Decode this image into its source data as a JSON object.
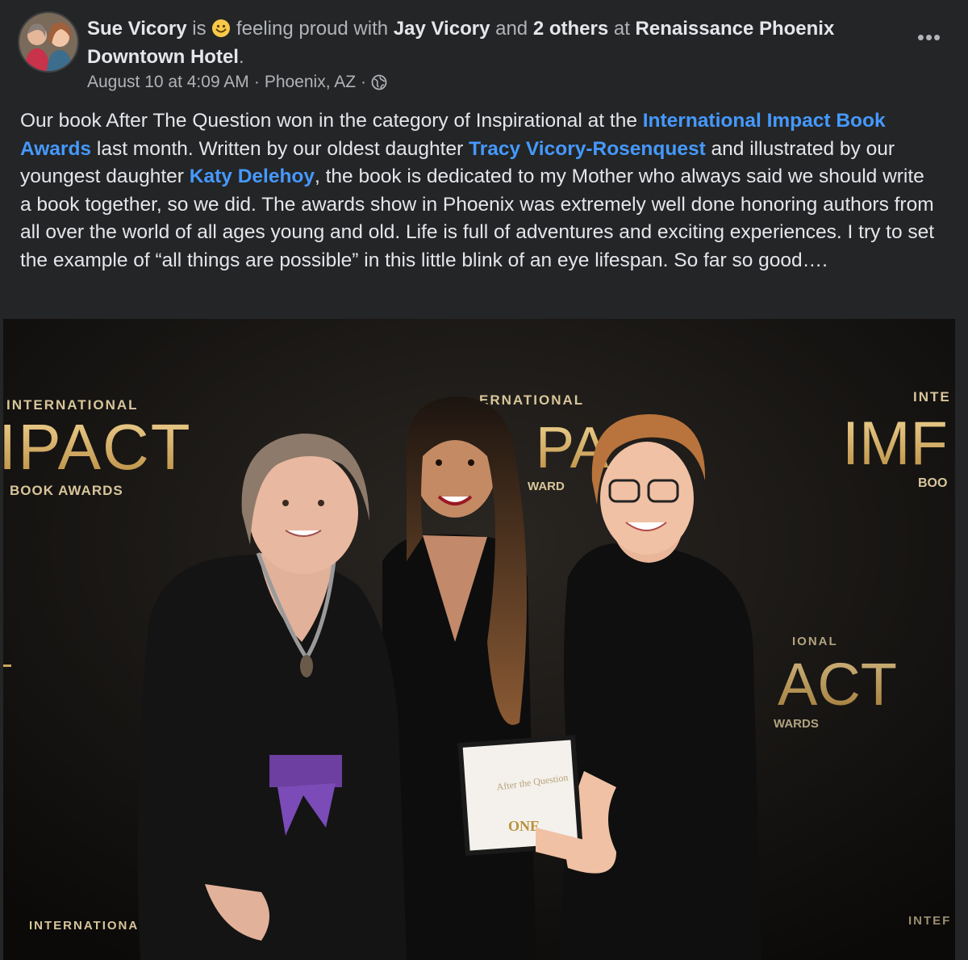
{
  "post": {
    "author": "Sue Vicory",
    "is_word": " is ",
    "feeling": " feeling proud",
    "with_word": " with ",
    "tagged_person": "Jay Vicory",
    "and_word": " and ",
    "others": "2 others",
    "at_word": " at ",
    "location": "Renaissance Phoenix Downtown Hotel",
    "period": ".",
    "timestamp": "August 10 at 4:09 AM",
    "sep1": " · ",
    "city": "Phoenix, AZ",
    "sep2": " · ",
    "privacy_icon": "globe-icon",
    "more_icon": "more-options-icon",
    "more_label": "•••"
  },
  "body": {
    "t1": "Our book After The Question won in the category of Inspirational at the ",
    "link1": "International Impact Book Awards",
    "t2": " last month. Written by our oldest daughter ",
    "link2": "Tracy Vicory-Rosenquest",
    "t3": " and illustrated by our youngest daughter ",
    "link3": "Katy Delehoy",
    "t4": ", the book is dedicated to my Mother who always said we should write a book together, so we did. The awards show in Phoenix was extremely well done honoring authors from all over the world of all ages young and old. Life is full of adventures and exciting experiences. I try to set the example of “all things are possible” in this little blink of an eye lifespan. So far so good…."
  },
  "photo": {
    "backdrop_left_top": "INTERNATIONAL",
    "backdrop_left_big": "IPACT",
    "backdrop_left_sub": "BOOK AWARDS",
    "backdrop_mid_top": "ERNATIONAL",
    "backdrop_mid_big": "PA",
    "backdrop_mid_sub": "WARD",
    "backdrop_right_top": "INTE",
    "backdrop_right_big": "IMF",
    "backdrop_right_sub": "BOO",
    "backdrop_r2_top": "IONAL",
    "backdrop_r2_big": "ACT",
    "backdrop_r2_sub": "WARDS",
    "backdrop_bl_top": "INTERNATIONAI",
    "backdrop_br_top": "INTEF",
    "certificate_title": "After the Question",
    "certificate_badge": "ONE",
    "colors": {
      "gold": "#c9a45c",
      "link": "#4599ff",
      "background": "#242526"
    }
  }
}
